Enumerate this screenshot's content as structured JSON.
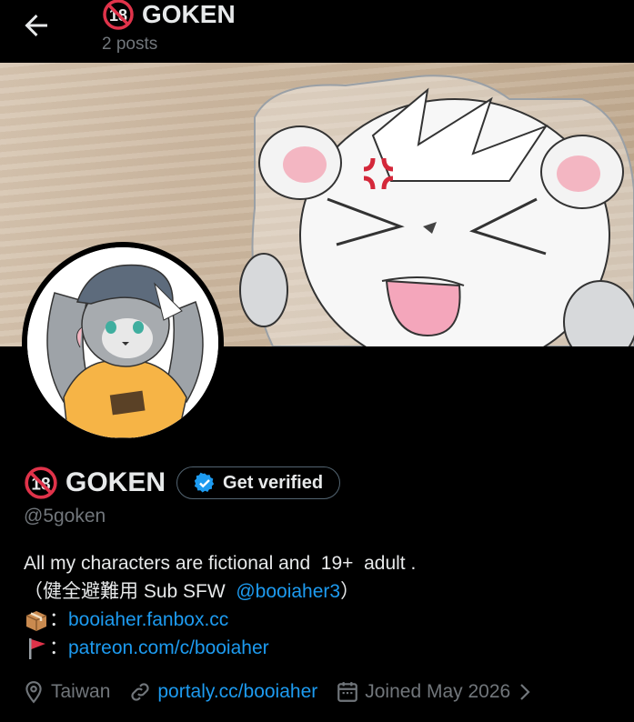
{
  "header": {
    "title": "GOKEN",
    "posts": "2 posts"
  },
  "profile": {
    "name": "GOKEN",
    "verify_label": "Get verified",
    "handle": "@5goken",
    "badge_text": "18"
  },
  "bio": {
    "line1": "All my characters are fictional and  19+  adult .",
    "line2_prefix": "（健全避難用 Sub SFW  ",
    "line2_link": "@booiaher3",
    "line2_suffix": "）",
    "line3_sep": "：",
    "line3_link": "booiaher.fanbox.cc",
    "line4_sep": "：",
    "line4_link": "patreon.com/c/booiaher"
  },
  "meta": {
    "location": "Taiwan",
    "website": "portaly.cc/booiaher",
    "joined": "Joined May 2026"
  },
  "colors": {
    "link": "#1d9bf0",
    "muted": "#71767b",
    "text": "#e7e9ea",
    "verified": "#1d9bf0"
  },
  "icons": [
    "back-arrow-icon",
    "no-under-18-icon",
    "verified-check-icon",
    "package-emoji-icon",
    "red-flag-emoji-icon",
    "location-pin-icon",
    "link-icon",
    "calendar-icon",
    "chevron-right-icon"
  ]
}
